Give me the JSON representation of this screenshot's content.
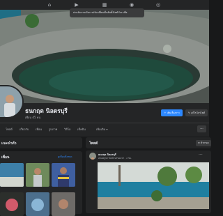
{
  "topbar": {
    "icons": [
      "home-icon",
      "video-icon",
      "marketplace-icon",
      "groups-icon",
      "gaming-icon"
    ],
    "tooltip": "ท่านจัดการแจ้งการปรับเปลี่ยนเป็นต้นตั้งไซต์ Esc เพื่อ"
  },
  "profile": {
    "name": "ธนกฤต นิลดรบุรี",
    "friends": "เพื่อน 45 คน",
    "add_story_label": "เพิ่มเรื่องราว",
    "edit_profile_label": "แก้ไขโปรไฟล์"
  },
  "tabs": [
    "โพสต์",
    "เกี่ยวกับ",
    "เพื่อน",
    "รูปภาพ",
    "วิดีโอ",
    "เช็คอิน",
    "เพิ่มเติม ▾"
  ],
  "tabs_more_label": "···",
  "intro": {
    "title": "แนะนำตัว"
  },
  "friends_card": {
    "title": "เพื่อน",
    "link": "ดูเพื่อนทั้งหมด"
  },
  "posts": {
    "title": "โพสต์",
    "filter_label": "ตัวกรอง",
    "author": "ธนกฤต นิลดรบุรี",
    "subline": "อัปเดตรูปภาพหน้าปกของเขา · 2 ชม.",
    "more_label": "···"
  }
}
